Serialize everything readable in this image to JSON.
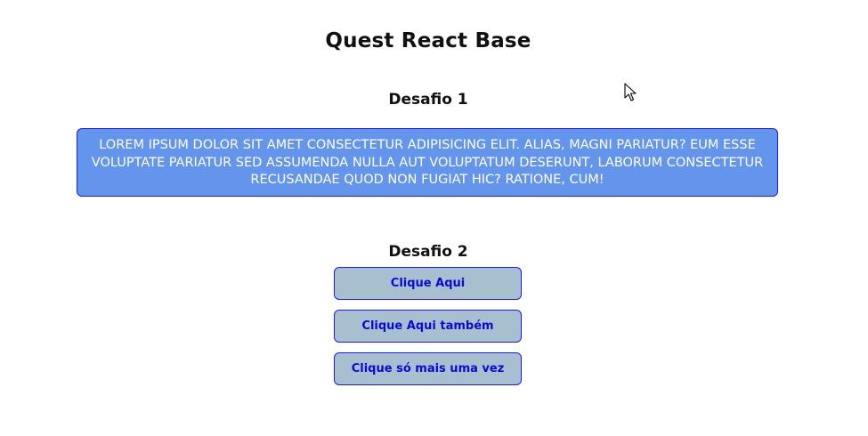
{
  "page": {
    "title": "Quest React Base"
  },
  "desafio1": {
    "heading": "Desafio 1",
    "text": "Lorem ipsum dolor sit amet consectetur adipisicing elit. Alias, magni pariatur? Eum esse voluptate pariatur sed assumenda nulla aut voluptatum deserunt, laborum consectetur recusandae quod non fugiat hic? Ratione, cum!"
  },
  "desafio2": {
    "heading": "Desafio 2",
    "buttons": [
      {
        "label": "Clique Aqui"
      },
      {
        "label": "Clique Aqui também"
      },
      {
        "label": "Clique só mais uma vez"
      }
    ]
  },
  "colors": {
    "box_background": "#6495ed",
    "button_background": "#a7bfcf",
    "border_blue": "#1a1aff",
    "button_text": "#0a0ad8"
  },
  "cursor": {
    "icon": "mouse-pointer-icon"
  }
}
